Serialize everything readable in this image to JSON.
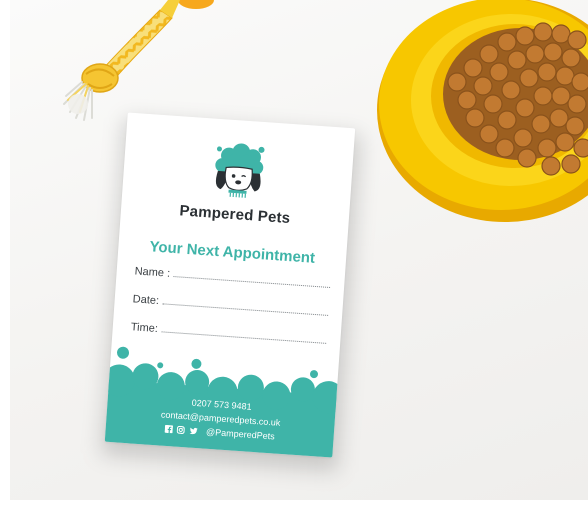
{
  "card": {
    "brand_name": "Pampered Pets",
    "headline": "Your Next Appointment",
    "fields": [
      {
        "label": "Name :"
      },
      {
        "label": "Date:"
      },
      {
        "label": "Time:"
      }
    ],
    "phone": "0207 573 9481",
    "email": "contact@pamperedpets.co.uk",
    "social_handle": "@PamperedPets",
    "social_icons": [
      "facebook-icon",
      "instagram-icon",
      "twitter-icon"
    ]
  },
  "colors": {
    "teal": "#3fb4a8",
    "dark_text": "#2b3034",
    "bowl_yellow": "#f7c700",
    "kibble_brown": "#b8732c",
    "toy_yellow": "#f6cf3a"
  }
}
